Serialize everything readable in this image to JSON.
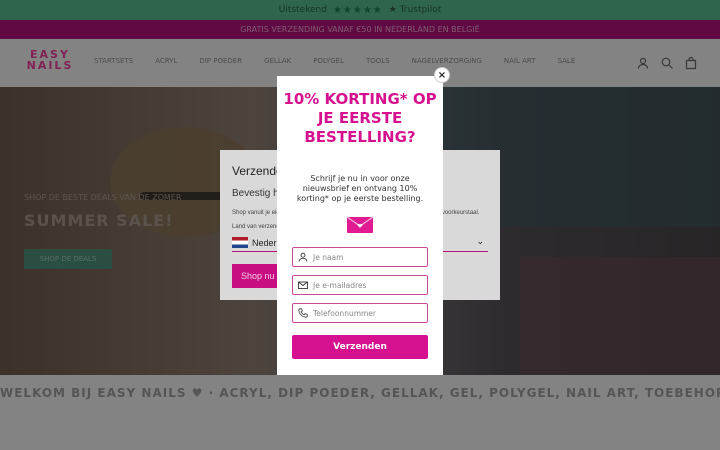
{
  "topbar": {
    "text": "Uitstekend",
    "stars": "★★★★★",
    "brand": "★ Trustpilot"
  },
  "promobar": {
    "text": "GRATIS VERZENDING VANAF €50 IN NEDERLAND EN BELGIË"
  },
  "header": {
    "logo_line1": "EASY",
    "logo_line2": "NAILS",
    "nav": [
      "STARTSETS",
      "ACRYL",
      "DIP POEDER",
      "GELLAK",
      "POLYGEL",
      "TOOLS",
      "NAGELVERZORGING",
      "NAIL ART",
      "SALE"
    ]
  },
  "hero": {
    "subtitle": "SHOP DE BESTE DEALS VAN DE ZOMER",
    "title": "SUMMER SALE!",
    "button": "SHOP DE DEALS"
  },
  "ticker": {
    "text": "WELKOM BIJ EASY NAILS ♥ · ACRYL, DIP POEDER, GELLAK, GEL, POLYGEL, NAIL ART, TOEBEHOREN"
  },
  "country_modal": {
    "title": "Verzenden naar Nederland",
    "subtitle": "Bevestig het land van verzending",
    "text": "Shop vanuit je eigen land, de inhoud en prijzen worden dan weergegeven in je voorkeurstaal.",
    "select_label": "Land van verzending",
    "select_value": "Nederland",
    "button": "Shop nu"
  },
  "popup": {
    "close": "×",
    "title": "10% KORTING* OP JE EERSTE BESTELLING?",
    "description": "Schrijf je nu in voor onze nieuwsbrief en ontvang 10% korting* op je eerste bestelling.",
    "name_placeholder": "Je naam",
    "email_placeholder": "Je e-mailadres",
    "phone_placeholder": "Telefoonnummer",
    "submit": "Verzenden"
  },
  "colors": {
    "accent": "#d6118f",
    "promobar": "#b01279",
    "trustpilot": "#58b98c"
  }
}
